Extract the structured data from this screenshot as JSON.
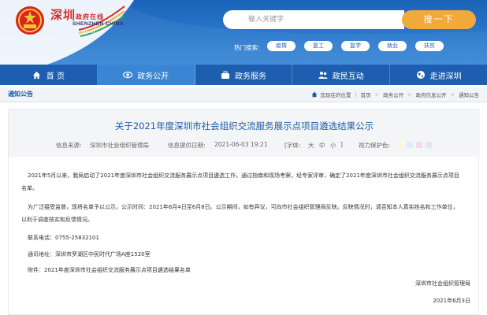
{
  "header": {
    "logo_cn": "深圳",
    "logo_cn_suffix": "政府在线",
    "logo_en": "SHENZHEN CHINA",
    "logo_url": "www.sz.gov.cn",
    "search_placeholder": "输入关键字",
    "search_button": "搜一下",
    "hot_label": "热门搜索:",
    "hot_tags": [
      "疫情",
      "复工",
      "复学",
      "就业",
      "扶贫"
    ]
  },
  "nav": {
    "items": [
      {
        "label": "首  页",
        "icon": "home-icon"
      },
      {
        "label": "政务公开",
        "icon": "eye-icon"
      },
      {
        "label": "政务服务",
        "icon": "briefcase-icon"
      },
      {
        "label": "政民互动",
        "icon": "people-icon"
      },
      {
        "label": "走进深圳",
        "icon": "globe-icon"
      }
    ],
    "active_index": 1
  },
  "breadcrumb": {
    "section": "通知公告",
    "location_label": "您现在的位置",
    "items": [
      "首页",
      "政务公开",
      "政府信息公开",
      "通知公告"
    ]
  },
  "article": {
    "title": "关于2021年度深圳市社会组织交流服务展示点项目遴选结果公示",
    "source_label": "信息来源:",
    "source": "深圳市社会组织管理局",
    "date_label": "信息提供日期:",
    "date": "2021-06-03 19:21",
    "font_label": "[字体:",
    "font_large": "大",
    "font_medium": "中",
    "font_small": "小",
    "font_end": "]",
    "vision_label": "视力保护色:",
    "vision_colors": [
      "#fdf7d4",
      "#dbeef8",
      "#f3d9f0",
      "#e6e6e6"
    ],
    "p1": "2021年5月以来，我局启动了2021年度深圳市社会组织交流服务展示点项目遴选工作。通过指南和现场考察，经专家评审，确定了2021年度深圳市社会组织交流服务展示点项目",
    "p1b": "名单。",
    "p2": "为广泛接受监督，现将名单予以公示。公示时间：2021年6月4日至6月8日。公示期间，如有异议，可向市社会组织管理局反映。反映情况时，请否知本人真实姓名和工作单位，",
    "p2b": "以利于调查核实和反馈情况。",
    "contact_phone": "联系电话：0755-25832101",
    "contact_addr": "通讯地址：深圳市罗湖区中民时代广场A座1520室",
    "attachment": "附件：2021年度深圳市社会组织交流服务展示点项目遴选结果名单",
    "signature": "深圳市社会组织管理局",
    "sign_date": "2021年6月3日"
  }
}
